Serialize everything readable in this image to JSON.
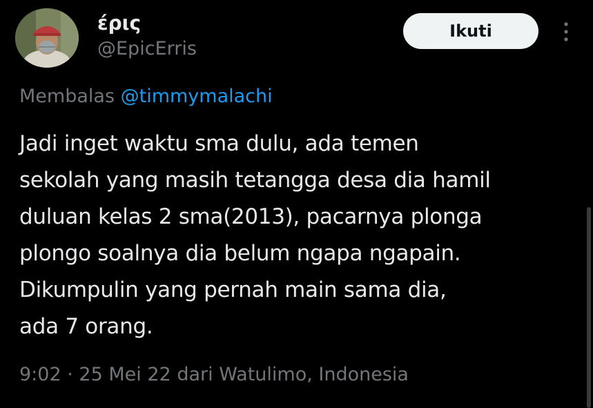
{
  "author": {
    "display_name": "έρις",
    "handle": "@EpicErris"
  },
  "header": {
    "follow_label": "Ikuti",
    "more_icon": "more-vertical-icon"
  },
  "reply": {
    "prefix": "Membalas",
    "mention": "@timmymalachi"
  },
  "tweet": {
    "lines": [
      "Jadi inget waktu sma dulu, ada temen",
      "sekolah yang masih tetangga desa dia hamil",
      "duluan kelas 2 sma(2013), pacarnya plonga",
      "plongo soalnya dia belum ngapa ngapain.",
      "Dikumpulin yang pernah main sama dia,",
      "ada 7 orang."
    ]
  },
  "meta": {
    "time": "9:02",
    "separator": "·",
    "date": "25 Mei 22",
    "from_prefix": "dari",
    "location": "Watulimo, Indonesia"
  },
  "colors": {
    "background": "#000000",
    "text": "#e7e9ea",
    "secondary": "#71767b",
    "link": "#1d9bf0",
    "button_bg": "#eff3f4"
  }
}
